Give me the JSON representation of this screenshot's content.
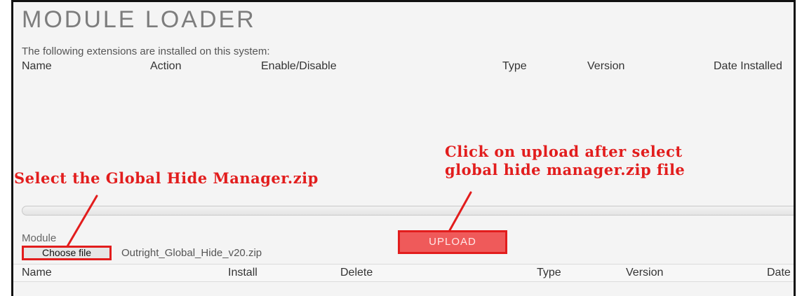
{
  "page": {
    "title": "MODULE LOADER",
    "subtitle": "The following extensions are installed on this system:"
  },
  "installed_table": {
    "columns": [
      "Name",
      "Action",
      "Enable/Disable",
      "Type",
      "Version",
      "Date Installed"
    ]
  },
  "upload": {
    "module_label": "Module",
    "choose_file_label": "Choose file",
    "selected_file": "Outright_Global_Hide_v20.zip",
    "upload_label": "UPLOAD"
  },
  "available_table": {
    "columns": [
      "Name",
      "Install",
      "Delete",
      "Type",
      "Version",
      "Date P"
    ]
  },
  "annotations": {
    "left": "Select the Global Hide Manager.zip",
    "right_line1": "Click on upload after select",
    "right_line2": "global hide manager.zip file"
  },
  "colors": {
    "annotation": "#e21d1d",
    "upload_fill": "#ef5a5a",
    "title_gray": "#7d7d7d"
  }
}
